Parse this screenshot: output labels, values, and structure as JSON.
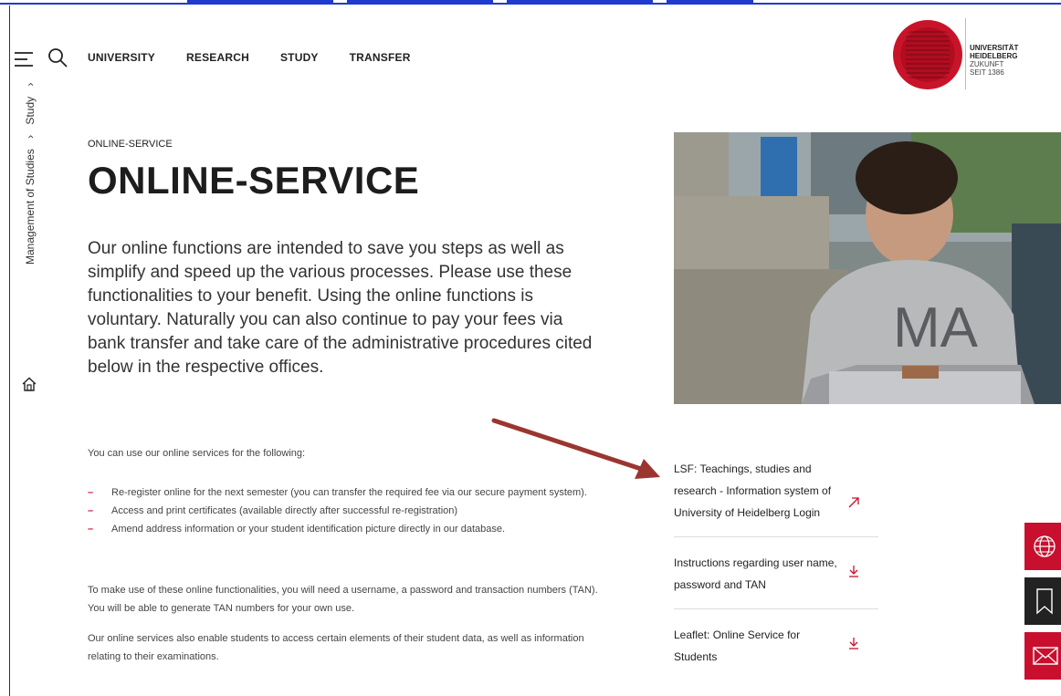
{
  "nav": {
    "items": [
      "UNIVERSITY",
      "RESEARCH",
      "STUDY",
      "TRANSFER"
    ]
  },
  "logo": {
    "line1": "UNIVERSITÄT",
    "line2": "HEIDELBERG",
    "line3": "ZUKUNFT",
    "line4": "SEIT 1386"
  },
  "breadcrumb": {
    "items": [
      "Management of Studies",
      "Study"
    ]
  },
  "page": {
    "eyebrow": "ONLINE-SERVICE",
    "title": "ONLINE-SERVICE",
    "intro": "Our online functions are intended to save you steps as well as simplify and speed up the various processes. Please use these functionalities to your benefit. Using the online functions is voluntary. Naturally you can also continue to pay your fees via bank transfer and take care of the administrative procedures cited below in the respective offices.",
    "lead": "You can use our online services for the following:",
    "bullets": [
      "Re-register online for the next semester (you can transfer the required fee via our secure payment system).",
      "Access and print certificates (available directly after successful re-registration)",
      "Amend address information or your student identification picture directly in our database."
    ],
    "para1": "To make use of these online functionalities, you will need a username, a password and transaction numbers (TAN). You will be able to generate TAN numbers for your own use.",
    "para2": "Our online services also enable students to access certain elements of their student data, as well as information relating to their examinations."
  },
  "links": [
    {
      "label": "LSF: Teachings, studies and research - Information system of University of Heidelberg Login",
      "icon": "external-link-icon"
    },
    {
      "label": "Instructions regarding user name, password and TAN",
      "icon": "download-icon"
    },
    {
      "label": "Leaflet: Online Service for Students",
      "icon": "download-icon"
    }
  ],
  "side_buttons": [
    "globe-icon",
    "bookmark-icon",
    "mail-icon"
  ],
  "colors": {
    "accent": "#c8102e",
    "dark": "#2a2a2a",
    "topline": "#1f3bd1",
    "annotation_arrow": "#9b3530"
  }
}
